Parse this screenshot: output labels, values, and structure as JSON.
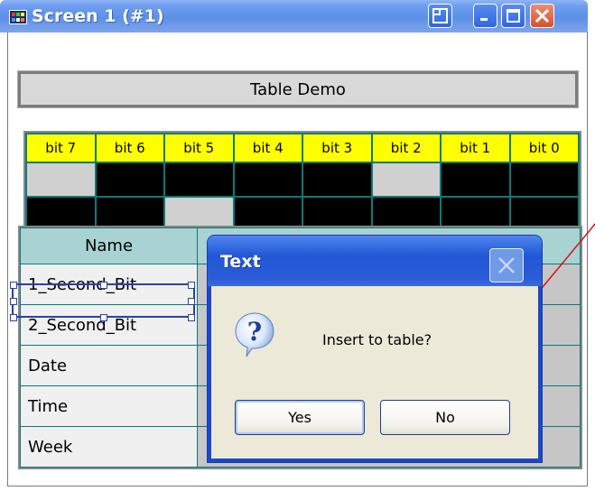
{
  "window": {
    "title": "Screen 1 (#1)"
  },
  "caption": "Table Demo",
  "bit_table": {
    "headers": [
      "bit 7",
      "bit 6",
      "bit 5",
      "bit 4",
      "bit 3",
      "bit 2",
      "bit 1",
      "bit 0"
    ],
    "rows": [
      [
        1,
        0,
        0,
        0,
        0,
        1,
        0,
        0
      ],
      [
        0,
        0,
        1,
        0,
        0,
        0,
        0,
        0
      ]
    ]
  },
  "data_table": {
    "header": "Name",
    "rows": [
      "1_Second_Bit",
      "2_Second_Bit",
      "Date",
      "Time",
      "Week"
    ]
  },
  "dialog": {
    "title": "Text",
    "message": "Insert to table?",
    "yes_label": "Yes",
    "no_label": "No",
    "icon": "question-icon"
  },
  "colors": {
    "titlebar": "#5d8fe6",
    "dialog_titlebar": "#2156d6",
    "bit_header": "#ffff00",
    "grid": "#0b7a78",
    "dialog_body": "#ece9d8"
  }
}
